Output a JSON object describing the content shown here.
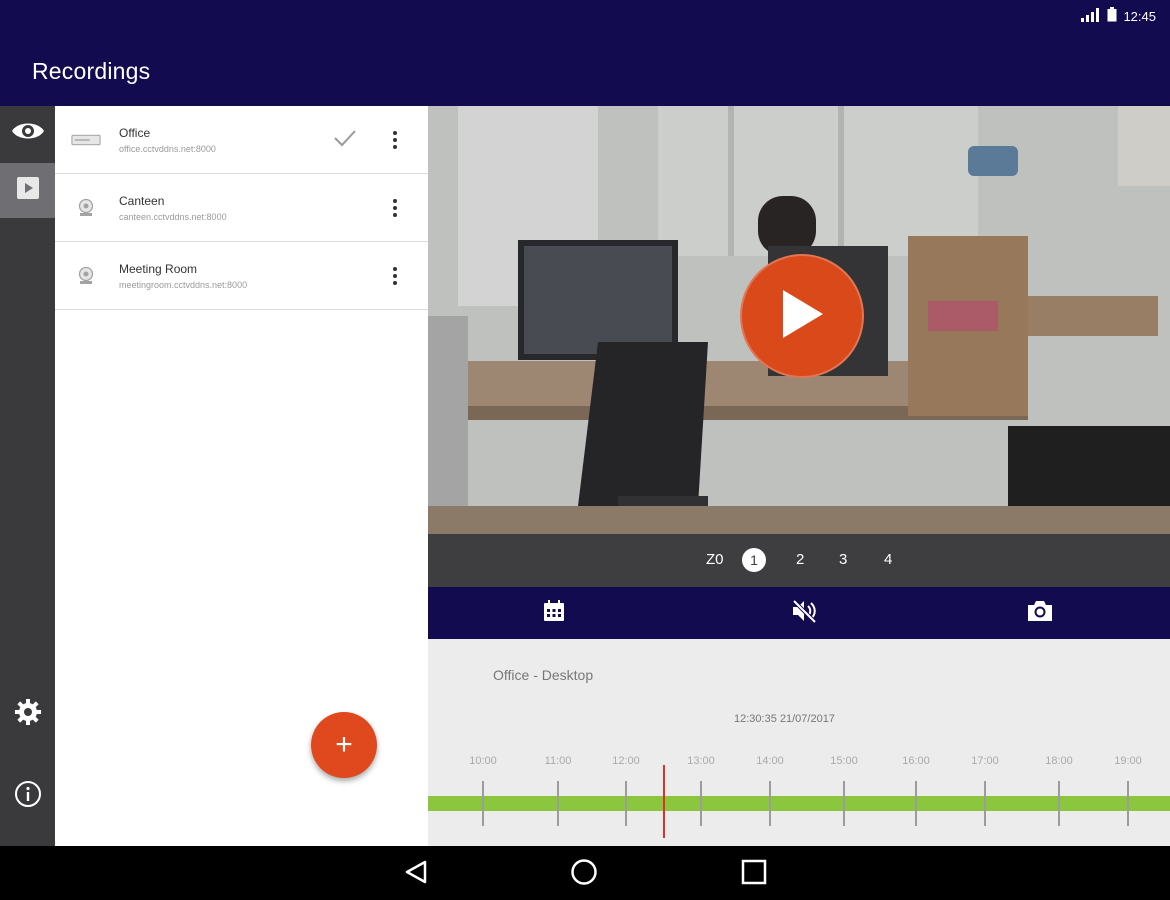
{
  "status": {
    "time": "12:45",
    "signal_icon": "signal-icon",
    "battery_icon": "battery-icon"
  },
  "appbar": {
    "title": "Recordings"
  },
  "rail": {
    "items": [
      {
        "icon": "eye-icon",
        "active": false
      },
      {
        "icon": "play-square-icon",
        "active": true
      }
    ],
    "bottom": [
      {
        "icon": "gear-icon"
      },
      {
        "icon": "info-icon"
      }
    ]
  },
  "devices": [
    {
      "name": "Office",
      "address": "office.cctvddns.net:8000",
      "icon": "recorder-icon",
      "selected": true
    },
    {
      "name": "Canteen",
      "address": "canteen.cctvddns.net:8000",
      "icon": "camera-icon",
      "selected": false
    },
    {
      "name": "Meeting Room",
      "address": "meetingroom.cctvddns.net:8000",
      "icon": "camera-icon",
      "selected": false
    }
  ],
  "fab": {
    "label": "+"
  },
  "pager": {
    "zoom_label": "Z0",
    "pages": [
      "1",
      "2",
      "3",
      "4"
    ],
    "active_page": "1"
  },
  "toolbar": {
    "icons": [
      "calendar-icon",
      "mute-icon",
      "camera-snapshot-icon"
    ]
  },
  "timeline": {
    "camera_title": "Office - Desktop",
    "timestamp": "12:30:35   21/07/2017",
    "hours": [
      "10:00",
      "11:00",
      "12:00",
      "13:00",
      "14:00",
      "15:00",
      "16:00",
      "17:00",
      "18:00",
      "19:00"
    ],
    "colors": {
      "track": "#8cc63f",
      "cursor": "#e0302a"
    }
  },
  "colors": {
    "brand": "#130b4f",
    "accent": "#e0481d"
  }
}
